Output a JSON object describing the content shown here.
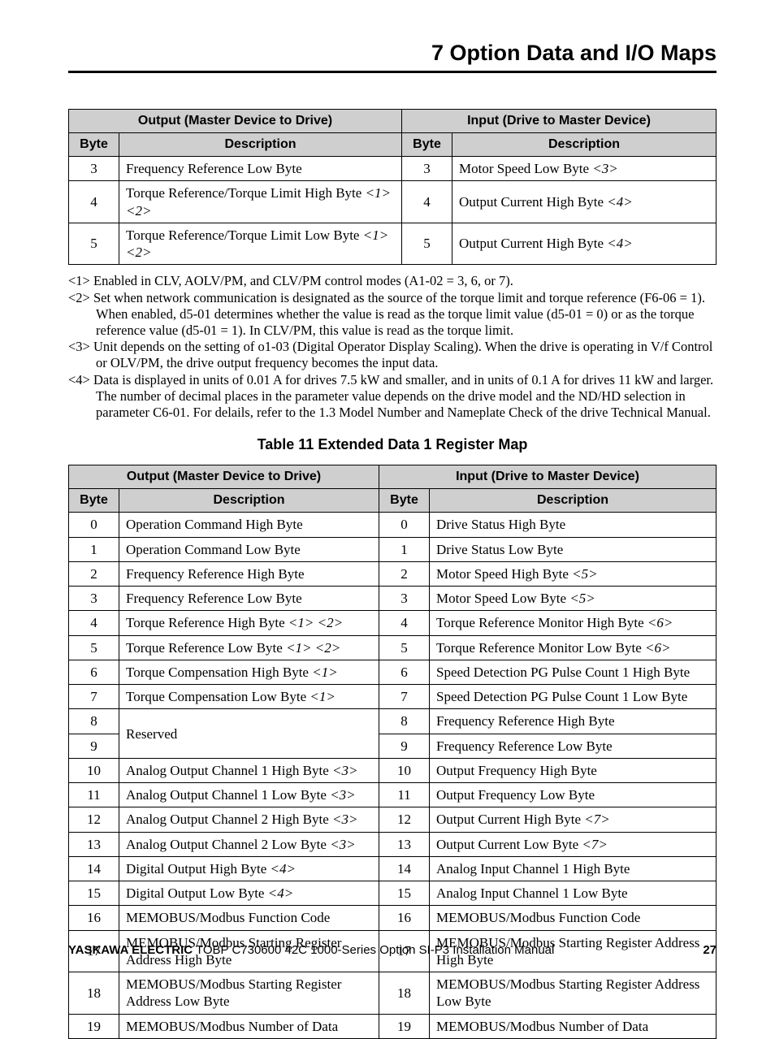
{
  "header": {
    "section": "7  Option Data and I/O Maps"
  },
  "table1": {
    "head": {
      "out": "Output (Master Device to Drive)",
      "in": "Input (Drive to Master Device)",
      "byte": "Byte",
      "desc": "Description"
    },
    "rows": [
      {
        "ob": "3",
        "od": "Frequency Reference Low Byte",
        "or": "",
        "ib": "3",
        "id": "Motor Speed Low Byte ",
        "ir": "<3>"
      },
      {
        "ob": "4",
        "od": "Torque Reference/Torque Limit High Byte ",
        "or": "<1> <2>",
        "ib": "4",
        "id": "Output Current High Byte ",
        "ir": "<4>"
      },
      {
        "ob": "5",
        "od": "Torque Reference/Torque Limit Low Byte ",
        "or": "<1> <2>",
        "ib": "5",
        "id": "Output Current High Byte ",
        "ir": "<4>"
      }
    ]
  },
  "notes": [
    "<1> Enabled in CLV, AOLV/PM, and CLV/PM control modes (A1-02 = 3, 6, or 7).",
    "<2> Set when network communication is designated as the source of the torque limit and torque reference (F6-06 = 1). When enabled, d5-01 determines whether the value is read as the torque limit value (d5-01 = 0) or as the torque reference value (d5-01 = 1). In CLV/PM, this value is read as the torque limit.",
    "<3> Unit depends on the setting of o1-03 (Digital Operator Display Scaling). When the drive is operating in V/f Control or OLV/PM, the drive output frequency becomes the input data.",
    "<4> Data is displayed in units of 0.01 A for drives 7.5 kW and smaller, and in units of 0.1 A for drives 11 kW and larger. The number of decimal places in the parameter value depends on the drive model and the ND/HD selection in parameter C6-01. For delails, refer to the 1.3 Model Number and Nameplate Check of the drive Technical Manual."
  ],
  "caption2": "Table 11  Extended Data 1 Register Map",
  "table2": {
    "head": {
      "out": "Output (Master Device to Drive)",
      "in": "Input (Drive to Master Device)",
      "byte": "Byte",
      "desc": "Description"
    },
    "rows": [
      {
        "ob": "0",
        "od": "Operation Command High Byte",
        "or": "",
        "ib": "0",
        "id": "Drive Status High Byte",
        "ir": ""
      },
      {
        "ob": "1",
        "od": "Operation Command Low Byte",
        "or": "",
        "ib": "1",
        "id": "Drive Status Low Byte",
        "ir": ""
      },
      {
        "ob": "2",
        "od": "Frequency Reference High Byte",
        "or": "",
        "ib": "2",
        "id": "Motor Speed High Byte ",
        "ir": "<5>"
      },
      {
        "ob": "3",
        "od": "Frequency Reference Low Byte",
        "or": "",
        "ib": "3",
        "id": "Motor Speed Low Byte ",
        "ir": "<5>"
      },
      {
        "ob": "4",
        "od": "Torque Reference High Byte ",
        "or": "<1> <2>",
        "ib": "4",
        "id": "Torque Reference Monitor High Byte  ",
        "ir": "<6>"
      },
      {
        "ob": "5",
        "od": "Torque Reference Low Byte ",
        "or": "<1> <2>",
        "ib": "5",
        "id": "Torque Reference Monitor Low Byte ",
        "ir": "<6>"
      },
      {
        "ob": "6",
        "od": "Torque Compensation High Byte ",
        "or": "<1>",
        "ib": "6",
        "id": "Speed Detection PG Pulse Count 1 High Byte",
        "ir": ""
      },
      {
        "ob": "7",
        "od": "Torque Compensation Low Byte ",
        "or": "<1>",
        "ib": "7",
        "id": "Speed Detection PG Pulse Count 1 Low Byte",
        "ir": ""
      },
      {
        "ob": "8",
        "od": "__MERGE_START__Reserved",
        "or": "",
        "ib": "8",
        "id": "Frequency Reference High Byte",
        "ir": ""
      },
      {
        "ob": "9",
        "od": "__MERGE__",
        "or": "",
        "ib": "9",
        "id": "Frequency Reference Low Byte",
        "ir": ""
      },
      {
        "ob": "10",
        "od": "Analog Output Channel 1 High Byte ",
        "or": "<3>",
        "ib": "10",
        "id": "Output Frequency High Byte",
        "ir": ""
      },
      {
        "ob": "11",
        "od": "Analog Output Channel 1 Low Byte ",
        "or": "<3>",
        "ib": "11",
        "id": "Output Frequency Low Byte",
        "ir": ""
      },
      {
        "ob": "12",
        "od": "Analog Output Channel 2 High Byte ",
        "or": "<3>",
        "ib": "12",
        "id": "Output Current High Byte ",
        "ir": "<7>"
      },
      {
        "ob": "13",
        "od": "Analog Output Channel 2 Low Byte ",
        "or": "<3>",
        "ib": "13",
        "id": "Output Current Low Byte ",
        "ir": "<7>"
      },
      {
        "ob": "14",
        "od": "Digital Output High Byte ",
        "or": "<4>",
        "ib": "14",
        "id": "Analog Input Channel 1 High Byte",
        "ir": ""
      },
      {
        "ob": "15",
        "od": "Digital Output Low Byte ",
        "or": "<4>",
        "ib": "15",
        "id": "Analog Input Channel 1 Low Byte",
        "ir": ""
      },
      {
        "ob": "16",
        "od": "MEMOBUS/Modbus Function Code",
        "or": "",
        "ib": "16",
        "id": "MEMOBUS/Modbus Function Code",
        "ir": ""
      },
      {
        "ob": "17",
        "od": "MEMOBUS/Modbus Starting Register Address High Byte",
        "or": "",
        "ib": "17",
        "id": "MEMOBUS/Modbus Starting Register Address High Byte",
        "ir": ""
      },
      {
        "ob": "18",
        "od": "MEMOBUS/Modbus Starting Register Address Low Byte",
        "or": "",
        "ib": "18",
        "id": "MEMOBUS/Modbus Starting Register Address Low Byte",
        "ir": ""
      },
      {
        "ob": "19",
        "od": "MEMOBUS/Modbus Number of Data",
        "or": "",
        "ib": "19",
        "id": "MEMOBUS/Modbus Number of Data",
        "ir": ""
      }
    ]
  },
  "footer": {
    "brand": "YASKAWA ELECTRIC",
    "doc": " TOBP C730600 42C 1000-Series Option SI-P3 Installation Manual",
    "page": "27"
  }
}
